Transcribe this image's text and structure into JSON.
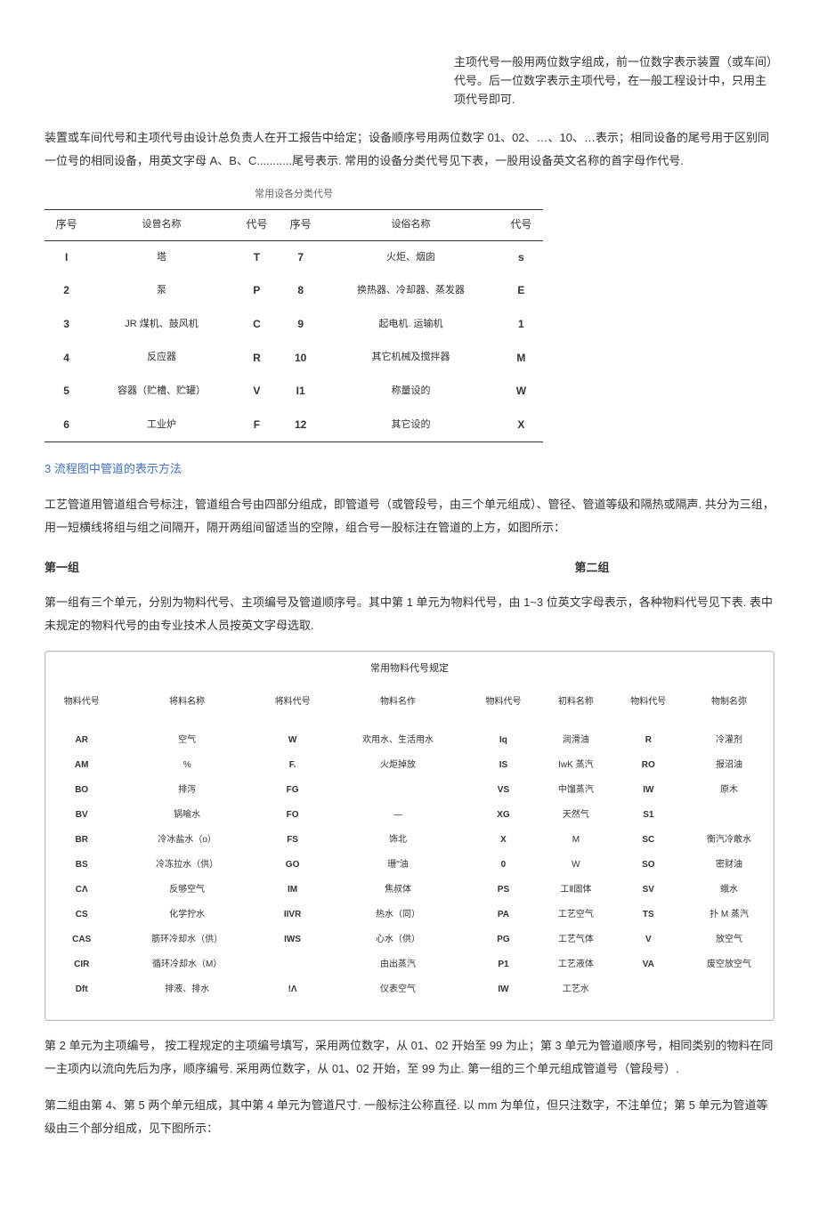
{
  "top_note": "主项代号一般用两位数字组成，前一位数字表示装置（或车间）代号。后一位数字表示主项代号，在一般工程设计中，只用主项代号即可.",
  "para1": "装置或车间代号和主项代号由设计总负责人在开工报告中给定；设备顺序号用两位数字 01、02、…、10、…表示；相同设备的尾号用于区别同一位号的相同设备，用英文字母 A、B、C...........尾号表示. 常用的设备分类代号见下表，一股用设备英文名称的首字母作代号.",
  "table1": {
    "title": "常用设各分类代号",
    "headers": [
      "序号",
      "设曾名称",
      "代号",
      "序号",
      "设俗名称",
      "代号"
    ],
    "rows": [
      [
        "I",
        "塔",
        "T",
        "7",
        "火炬、烟囱",
        "s"
      ],
      [
        "2",
        "泵",
        "P",
        "8",
        "换热器、冷却器、蒸发器",
        "E"
      ],
      [
        "3",
        "JR 煤机、鼓风机",
        "C",
        "9",
        "起电机. 运输机",
        "1"
      ],
      [
        "4",
        "反应器",
        "R",
        "10",
        "其它机械及搅拌器",
        "M"
      ],
      [
        "5",
        "容器（贮槽、贮罐）",
        "V",
        "I1",
        "称量设的",
        "W"
      ],
      [
        "6",
        "工业炉",
        "F",
        "12",
        "其它设的",
        "X"
      ]
    ]
  },
  "heading_3": "3 流程图中管道的表示方法",
  "para2": "工艺管道用管道组合号标注，管道组合号由四部分组成，即管道号（或管段号，由三个单元组成）、管径、管道等级和隔热或隔声. 共分为三组，用一短横线将组与组之间隔开，隔开两组间留适当的空隙，组合号一股标注在管道的上方，如图所示：",
  "group1_label": "第一组",
  "group2_label": "第二组",
  "para3": "第一组有三个单元，分别为物料代号、主项编号及管道顺序号。其中第 1 单元为物料代号，由 1~3 位英文字母表示，各种物料代号见下表. 表中未规定的物料代号的由专业技术人员按英文字母选取.",
  "table2": {
    "title": "常用物料代号规定",
    "headers": [
      "物料代号",
      "将料名称",
      "将料代号",
      "物料名作",
      "物料代号",
      "初料名称",
      "物料代号",
      "物制名弥"
    ],
    "rows": [
      [
        "AR",
        "空气",
        "W",
        "欢用水、生活用水",
        "Iq",
        "润滑油",
        "R",
        "冷灌剂"
      ],
      [
        "AM",
        "%",
        "F.",
        "火炬掉放",
        "IS",
        "IwK 蒸汽",
        "RO",
        "报沼油"
      ],
      [
        "BO",
        "排泻",
        "FG",
        "",
        "VS",
        "中馏蒸汽",
        "IW",
        "原木"
      ],
      [
        "BV",
        "锅喻水",
        "FO",
        "—",
        "XG",
        "天然气",
        "S1",
        ""
      ],
      [
        "BR",
        "冷冰盐水（o）",
        "FS",
        "饰北",
        "X",
        "M",
        "SC",
        "衡汽冷敢水"
      ],
      [
        "BS",
        "冷冻拉水（供）",
        "GO",
        "珊\"油",
        "0",
        "W",
        "SO",
        "密财油"
      ],
      [
        "CΛ",
        "反够空气",
        "IM",
        "焦叔体",
        "PS",
        "工Ⅱ固体",
        "SV",
        "蛾水"
      ],
      [
        "CS",
        "化学拧水",
        "IIVR",
        "热水（同）",
        "PA",
        "工艺空气",
        "TS",
        "扑 M 蒸汽"
      ],
      [
        "CAS",
        "筋环冷却水（供）",
        "IWS",
        "心水（供）",
        "PG",
        "工艺气体",
        "V",
        "放空气"
      ],
      [
        "CIR",
        "循环冷却水（M）",
        "",
        "由出蒸汽",
        "P1",
        "工艺液体",
        "VA",
        "废空放空气"
      ],
      [
        "Dft",
        "排液、排水",
        "!Λ",
        "仪表空气",
        "IW",
        "工艺水",
        "",
        ""
      ]
    ]
  },
  "para4": "第 2 单元为主项编号， 按工程规定的主项编号填写，采用两位数字，从 01、02 开始至 99 为止；第 3 单元为管道顺序号，相同类别的物料在同一主项内以流向先后为序，顺序编号. 采用两位数字，从 01、02 开始，至 99 为止. 第一组的三个单元组成管道号（管段号）.",
  "para5": "第二组由第 4、第 5 两个单元组成，其中第 4 单元为管道尺寸. 一般标注公称直径. 以 mm 为单位，但只注数字，不注单位；第 5 单元为管道等级由三个部分组成，见下图所示："
}
